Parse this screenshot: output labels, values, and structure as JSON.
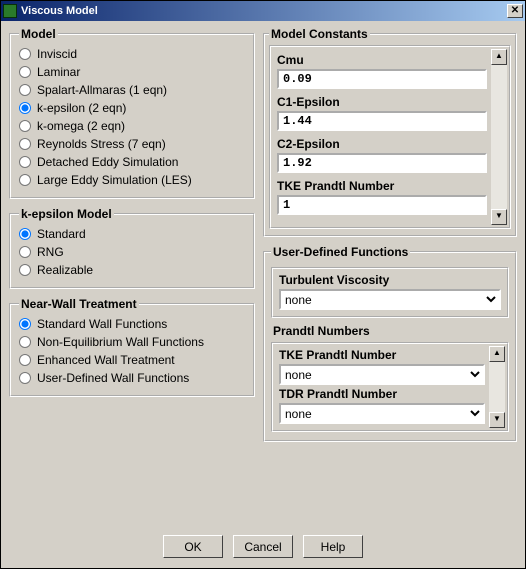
{
  "window": {
    "title": "Viscous Model"
  },
  "model": {
    "heading": "Model",
    "options": [
      {
        "label": "Inviscid",
        "checked": false
      },
      {
        "label": "Laminar",
        "checked": false
      },
      {
        "label": "Spalart-Allmaras   (1 eqn)",
        "checked": false
      },
      {
        "label": "k-epsilon   (2 eqn)",
        "checked": true
      },
      {
        "label": "k-omega   (2 eqn)",
        "checked": false
      },
      {
        "label": "Reynolds Stress   (7 eqn)",
        "checked": false
      },
      {
        "label": "Detached Eddy Simulation",
        "checked": false
      },
      {
        "label": "Large Eddy Simulation (LES)",
        "checked": false
      }
    ]
  },
  "ke_model": {
    "heading": "k-epsilon Model",
    "options": [
      {
        "label": "Standard",
        "checked": true
      },
      {
        "label": "RNG",
        "checked": false
      },
      {
        "label": "Realizable",
        "checked": false
      }
    ]
  },
  "near_wall": {
    "heading": "Near-Wall Treatment",
    "options": [
      {
        "label": "Standard Wall Functions",
        "checked": true
      },
      {
        "label": "Non-Equilibrium Wall Functions",
        "checked": false
      },
      {
        "label": "Enhanced Wall Treatment",
        "checked": false
      },
      {
        "label": "User-Defined Wall Functions",
        "checked": false
      }
    ]
  },
  "constants": {
    "heading": "Model Constants",
    "items": [
      {
        "label": "Cmu",
        "value": "0.09"
      },
      {
        "label": "C1-Epsilon",
        "value": "1.44"
      },
      {
        "label": "C2-Epsilon",
        "value": "1.92"
      },
      {
        "label": "TKE Prandtl Number",
        "value": "1"
      }
    ]
  },
  "udf": {
    "heading": "User-Defined Functions",
    "turb_visc": {
      "label": "Turbulent Viscosity",
      "value": "none"
    },
    "prandtl": {
      "heading": "Prandtl Numbers",
      "tke": {
        "label": "TKE Prandtl Number",
        "value": "none"
      },
      "tdr": {
        "label": "TDR Prandtl Number",
        "value": "none"
      }
    }
  },
  "buttons": {
    "ok": "OK",
    "cancel": "Cancel",
    "help": "Help"
  }
}
